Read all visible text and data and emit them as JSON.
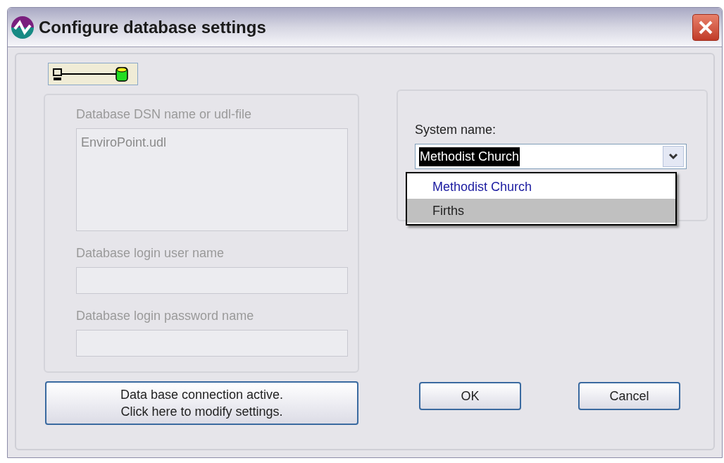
{
  "window": {
    "title": "Configure database settings"
  },
  "database_fields": [
    {
      "label": "Database DSN name or udl-file",
      "value": "EnviroPoint.udl",
      "kind": "multiline",
      "disabled": true
    },
    {
      "label": "Database login user name",
      "kind": "single",
      "disabled": true
    },
    {
      "label": "Database login password name",
      "kind": "single",
      "disabled": true
    }
  ],
  "system_name": {
    "label": "System name:",
    "value": "Methodist Church",
    "expanded": true,
    "options": [
      {
        "label": "Methodist Church",
        "selected": true,
        "highlighted": false
      },
      {
        "label": "Firths",
        "selected": false,
        "highlighted": true
      }
    ]
  },
  "connection_button": {
    "lines": [
      "Data base connection active.",
      "Click here to modify settings."
    ]
  },
  "buttons": [
    "OK",
    "Cancel"
  ]
}
